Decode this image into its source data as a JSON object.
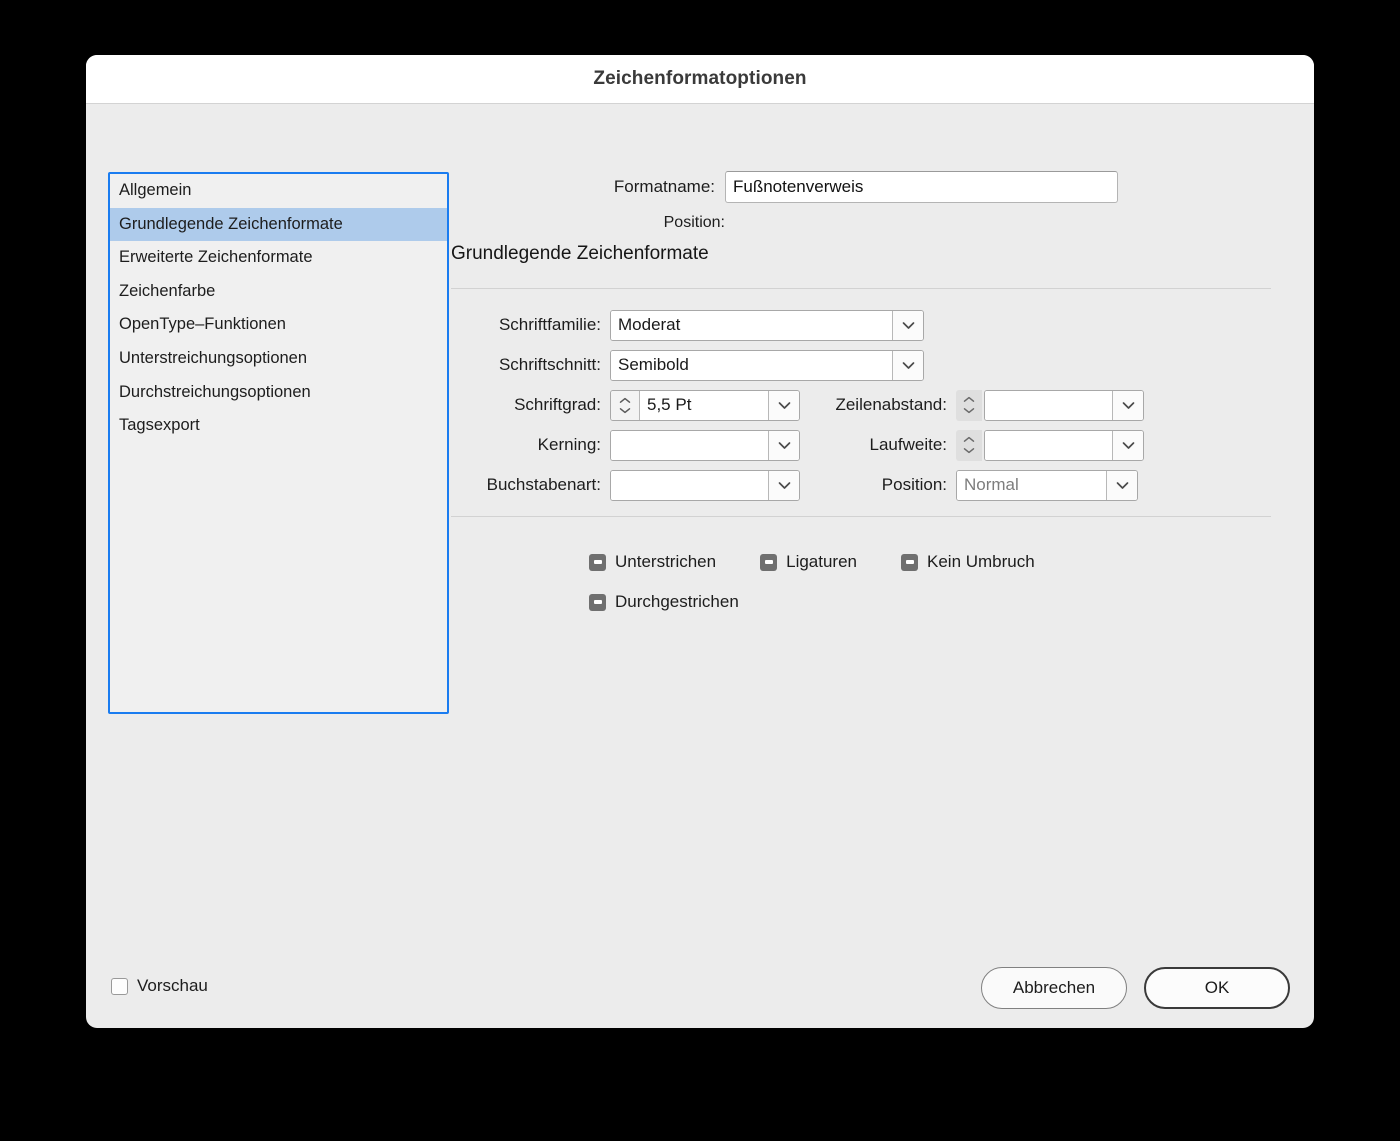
{
  "window": {
    "title": "Zeichenformatoptionen"
  },
  "sidebar": {
    "items": [
      {
        "label": "Allgemein",
        "selected": false
      },
      {
        "label": "Grundlegende Zeichenformate",
        "selected": true
      },
      {
        "label": "Erweiterte Zeichenformate",
        "selected": false
      },
      {
        "label": "Zeichenfarbe",
        "selected": false
      },
      {
        "label": "OpenType–Funktionen",
        "selected": false
      },
      {
        "label": "Unterstreichungsoptionen",
        "selected": false
      },
      {
        "label": "Durchstreichungsoptionen",
        "selected": false
      },
      {
        "label": "Tagsexport",
        "selected": false
      }
    ]
  },
  "header": {
    "formatname_label": "Formatname:",
    "formatname_value": "Fußnotenverweis",
    "position_label": "Position:",
    "position_value": "",
    "section_title": "Grundlegende Zeichenformate"
  },
  "fields": {
    "schriftfamilie": {
      "label": "Schriftfamilie:",
      "value": "Moderat"
    },
    "schriftschnitt": {
      "label": "Schriftschnitt:",
      "value": "Semibold"
    },
    "schriftgrad": {
      "label": "Schriftgrad:",
      "value": "5,5 Pt"
    },
    "zeilenabstand": {
      "label": "Zeilenabstand:",
      "value": ""
    },
    "kerning": {
      "label": "Kerning:",
      "value": ""
    },
    "laufweite": {
      "label": "Laufweite:",
      "value": ""
    },
    "buchstabenart": {
      "label": "Buchstabenart:",
      "value": ""
    },
    "position": {
      "label": "Position:",
      "value": "Normal"
    }
  },
  "checkboxes": {
    "unterstrichen": {
      "label": "Unterstrichen",
      "state": "mixed"
    },
    "ligaturen": {
      "label": "Ligaturen",
      "state": "mixed"
    },
    "kein_umbruch": {
      "label": "Kein Umbruch",
      "state": "mixed"
    },
    "durchgestrichen": {
      "label": "Durchgestrichen",
      "state": "mixed"
    }
  },
  "footer": {
    "preview_label": "Vorschau",
    "preview_checked": false,
    "cancel_label": "Abbrechen",
    "ok_label": "OK"
  },
  "colors": {
    "selection_blue": "#aecbeb",
    "focus_border_blue": "#1a7cf0",
    "dialog_bg": "#ececec",
    "titlebar_bg": "#ffffff",
    "checkbox_mixed": "#6f6f6f"
  }
}
